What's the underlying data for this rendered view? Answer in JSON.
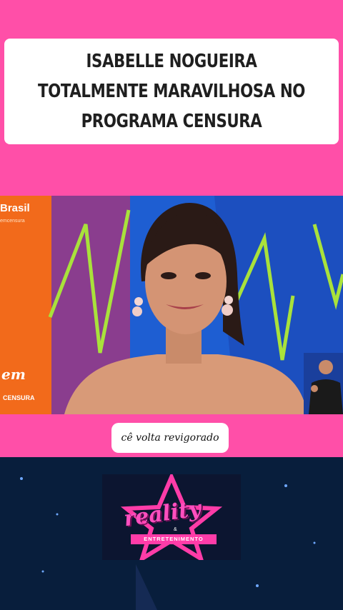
{
  "post": {
    "headline": "ISABELLE NOGUEIRA TOTALMENTE MARAVILHOSA NO PROGRAMA CENSURA",
    "subtitle": "cê volta revigorado"
  },
  "video": {
    "channel_logo_text": "Brasil",
    "channel_logo_sub": "emcensura",
    "show_logo_main": "em",
    "show_logo_sub": "CENSURA"
  },
  "watermark": {
    "title": "reality",
    "amp": "&",
    "subtitle": "ENTRETENIMENTO"
  },
  "colors": {
    "background_pink": "#ff4fa8",
    "set_blue": "#1e5ed2",
    "set_orange": "#f26a1b",
    "neon_green": "#a9e23b",
    "logo_pink": "#ff3ca8"
  }
}
